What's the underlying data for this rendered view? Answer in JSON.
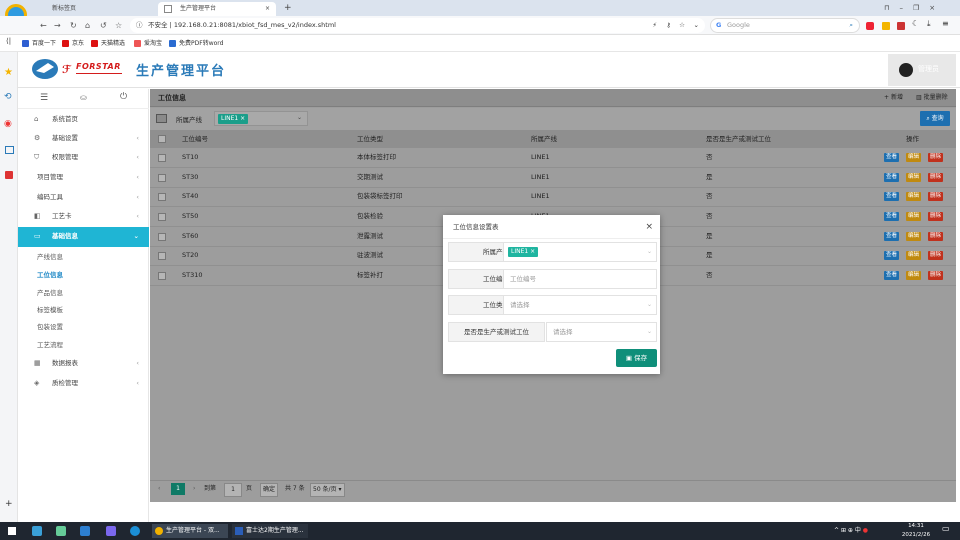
{
  "browser": {
    "tabs": [
      {
        "label": "新标签页"
      },
      {
        "label": "生产管理平台"
      }
    ],
    "security_label": "不安全",
    "url": "192.168.0.21:8081/xbiot_fsd_mes_v2/index.shtml",
    "search_engine": "Google",
    "bookmarks": [
      "百度一下",
      "京东",
      "天猫精选",
      "爱淘宝",
      "免费PDF转word"
    ]
  },
  "app": {
    "brand": "FORSTAR",
    "title": "生产管理平台",
    "user": "管理员"
  },
  "sidebar": {
    "items": [
      {
        "label": "系统首页",
        "icon": "home-icon"
      },
      {
        "label": "基础设置",
        "icon": "gear-icon"
      },
      {
        "label": "权限管理",
        "icon": "shield-icon"
      },
      {
        "label": "项目管理",
        "icon": ""
      },
      {
        "label": "编码工具",
        "icon": ""
      },
      {
        "label": "工艺卡",
        "icon": "card-icon"
      },
      {
        "label": "基础信息",
        "icon": "monitor-icon"
      },
      {
        "label": "数据报表",
        "icon": "table-icon"
      },
      {
        "label": "质检管理",
        "icon": "cube-icon"
      }
    ],
    "sub_items": [
      "产线信息",
      "工位信息",
      "产品信息",
      "标签模板",
      "包装设置",
      "工艺流程"
    ]
  },
  "panel": {
    "title": "工位信息",
    "add_label": "新增",
    "batch_delete_label": "批量删除",
    "filter_label": "所属产线",
    "filter_tag": "LINE1",
    "query_label": "查询"
  },
  "table": {
    "headers": [
      "工位编号",
      "工位类型",
      "所属产线",
      "是否是生产或测试工位",
      "操作"
    ],
    "rows": [
      [
        "ST10",
        "本体标签打印",
        "LINE1",
        "否"
      ],
      [
        "ST30",
        "交期测试",
        "LINE1",
        "是"
      ],
      [
        "ST40",
        "包装袋标签打印",
        "LINE1",
        "否"
      ],
      [
        "ST50",
        "包装检验",
        "LINE1",
        "否"
      ],
      [
        "ST60",
        "泄露测试",
        "LINE1",
        "是"
      ],
      [
        "ST20",
        "驻波测试",
        "LINE1",
        "是"
      ],
      [
        "ST310",
        "标签补打",
        "LINE1",
        "否"
      ]
    ],
    "actions": {
      "view": "查看",
      "edit": "编辑",
      "delete": "删除"
    }
  },
  "pager": {
    "current": "1",
    "goto_label": "到第",
    "page_value": "1",
    "page_unit": "页",
    "confirm": "确定",
    "total": "共 7 条",
    "page_size": "50 条/页"
  },
  "modal": {
    "title": "工位信息设置表",
    "fields": [
      {
        "label": "所属产线",
        "value": "LINE1",
        "placeholder": ""
      },
      {
        "label": "工位编号",
        "value": "",
        "placeholder": "工位编号"
      },
      {
        "label": "工位类型",
        "value": "",
        "placeholder": "请选择"
      },
      {
        "label": "是否是生产或测试工位",
        "value": "",
        "placeholder": "请选择"
      }
    ],
    "save_label": "保存"
  },
  "taskbar": {
    "items": [
      "生产管理平台 - 双...",
      "富士达2期生产管理..."
    ],
    "time": "14:31",
    "date": "2021/2/26",
    "ime": "中"
  },
  "colors": {
    "accent": "#1fb5d4",
    "brand": "#2a7ab8",
    "save": "#0f8f7a",
    "tag": "#1a9e8a"
  }
}
